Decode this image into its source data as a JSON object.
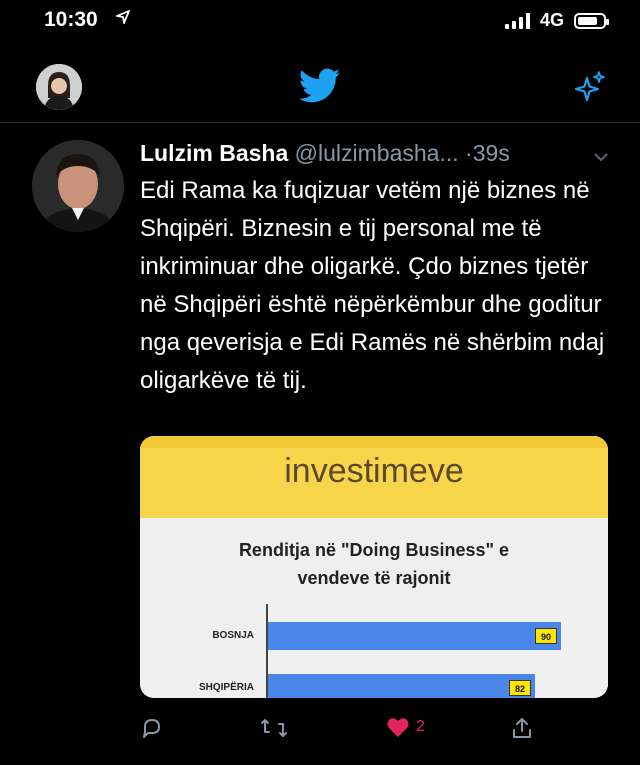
{
  "status_bar": {
    "time": "10:30",
    "network": "4G",
    "battery_level": 0.8
  },
  "tweet": {
    "author_name": "Lulzim Basha",
    "author_handle": "@lulzimbasha...",
    "separator": " ·",
    "timestamp": "39s",
    "text": "Edi Rama ka fuqizuar vetëm një biznes në Shqipëri. Biznesin e tij personal me të inkriminuar dhe oligarkë. Çdo biznes tjetër në Shqipëri është nëpërkëmbur dhe goditur nga qeverisja e Edi Ramës në shërbim ndaj oligarkëve të tij.",
    "media": {
      "heading": "investimeve",
      "chart_title_line1": "Renditja në \"Doing Business\" e",
      "chart_title_line2": "vendeve të rajonit"
    },
    "like_count": "2"
  },
  "chart_data": {
    "type": "bar",
    "title": "Renditja në \"Doing Business\" e vendeve të rajonit",
    "categories": [
      "BOSNJA",
      "SHQIPËRIA"
    ],
    "values": [
      90,
      82
    ],
    "orientation": "horizontal",
    "xlim": [
      0,
      100
    ]
  },
  "colors": {
    "accent": "#1da1f2",
    "like": "#e0245e",
    "muted": "#8899a6",
    "bar": "#4a86e8",
    "banner": "#f7d54a"
  }
}
